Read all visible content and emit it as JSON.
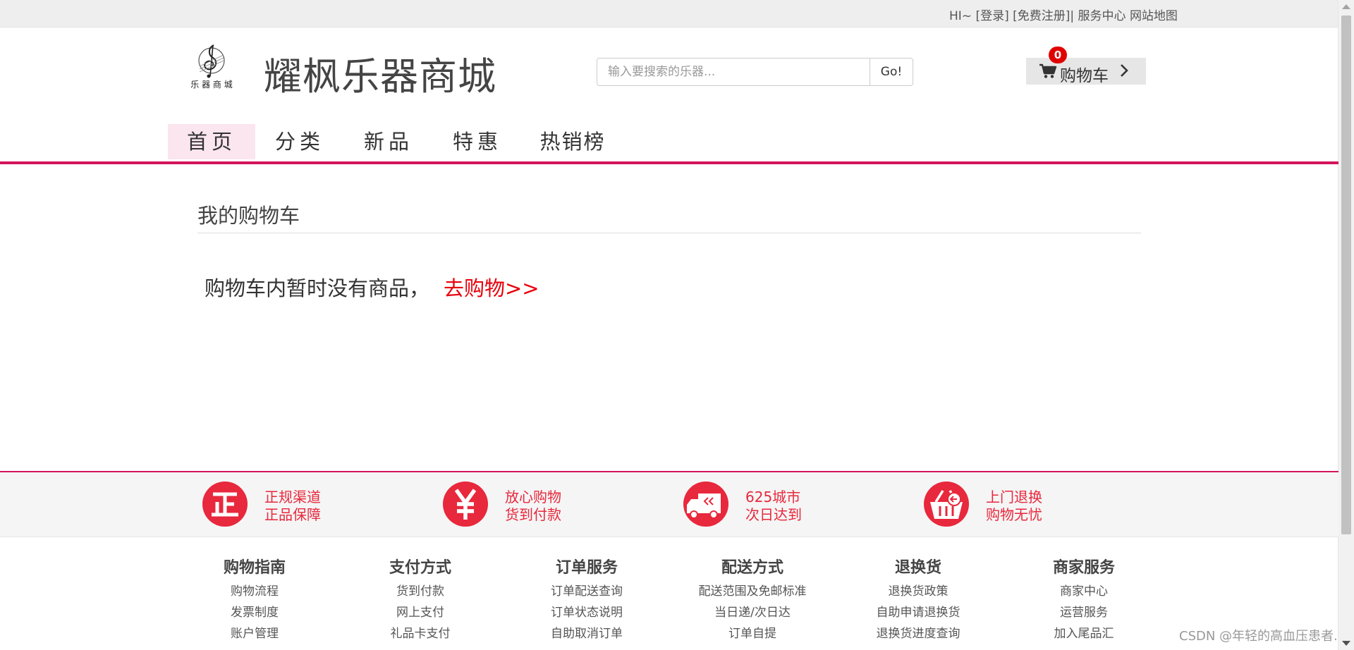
{
  "topbar": {
    "greeting": "HI~",
    "login": "[登录]",
    "register": "[免费注册]",
    "separator": "|",
    "service_center": "服务中心",
    "sitemap": "网站地图"
  },
  "header": {
    "logo_text": "乐 器 商 城",
    "site_title": "耀枫乐器商城",
    "search_placeholder": "输入要搜索的乐器...",
    "search_button": "Go!",
    "cart_label": "购物车",
    "cart_count": "0"
  },
  "nav": {
    "items": [
      {
        "label": "首页",
        "active": true
      },
      {
        "label": "分类",
        "active": false
      },
      {
        "label": "新品",
        "active": false
      },
      {
        "label": "特惠",
        "active": false
      },
      {
        "label": "热销榜",
        "active": false
      }
    ]
  },
  "main": {
    "heading": "我的购物车",
    "empty_message": "购物车内暂时没有商品，",
    "go_shopping": "去购物>>"
  },
  "guarantees": [
    {
      "icon": "zheng-icon",
      "line1": "正规渠道",
      "line2": "正品保障"
    },
    {
      "icon": "yen-icon",
      "line1": "放心购物",
      "line2": "货到付款"
    },
    {
      "icon": "truck-icon",
      "line1": "625城市",
      "line2": "次日达到"
    },
    {
      "icon": "basket-icon",
      "line1": "上门退换",
      "line2": "购物无忧"
    }
  ],
  "footer": {
    "columns": [
      {
        "title": "购物指南",
        "links": [
          "购物流程",
          "发票制度",
          "账户管理"
        ]
      },
      {
        "title": "支付方式",
        "links": [
          "货到付款",
          "网上支付",
          "礼品卡支付"
        ]
      },
      {
        "title": "订单服务",
        "links": [
          "订单配送查询",
          "订单状态说明",
          "自助取消订单"
        ]
      },
      {
        "title": "配送方式",
        "links": [
          "配送范围及免邮标准",
          "当日递/次日达",
          "订单自提"
        ]
      },
      {
        "title": "退换货",
        "links": [
          "退换货政策",
          "自助申请退换货",
          "退换货进度查询"
        ]
      },
      {
        "title": "商家服务",
        "links": [
          "商家中心",
          "运营服务",
          "加入尾品汇"
        ]
      }
    ]
  },
  "watermark": "CSDN @年轻的高血压患者.",
  "colors": {
    "accent": "#d4145a",
    "accent_light": "#fbe5ef",
    "link_red": "#e8000b",
    "guarantee_red": "#e8283c",
    "badge_red": "#e00000"
  }
}
